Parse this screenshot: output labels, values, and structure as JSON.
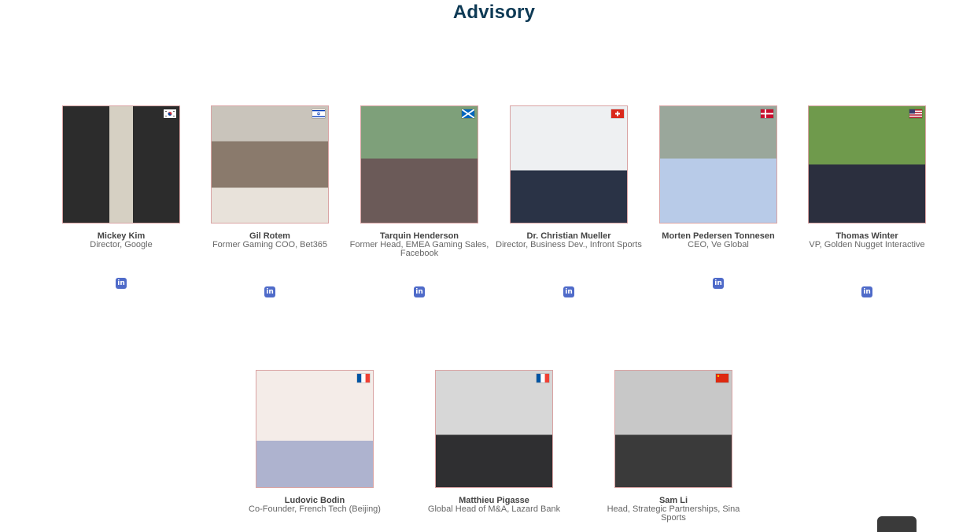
{
  "page": {
    "title": "Advisory"
  },
  "advisors_row1": [
    {
      "name": "Mickey Kim",
      "role": "Director, Google",
      "flag": "korea",
      "social_icon": "linkedin-icon"
    },
    {
      "name": "Gil Rotem",
      "role": "Former Gaming COO, Bet365",
      "flag": "israel",
      "social_icon": "linkedin-icon"
    },
    {
      "name": "Tarquin Henderson",
      "role": "Former Head, EMEA Gaming Sales, Facebook",
      "flag": "scotland",
      "social_icon": "linkedin-icon"
    },
    {
      "name": "Dr. Christian Mueller",
      "role": "Director, Business Dev., Infront Sports",
      "flag": "switzerland",
      "social_icon": "linkedin-icon"
    },
    {
      "name": "Morten Pedersen Tonnesen",
      "role": "CEO, Ve Global",
      "flag": "denmark",
      "social_icon": "linkedin-icon"
    },
    {
      "name": "Thomas Winter",
      "role": "VP, Golden Nugget Interactive",
      "flag": "usa",
      "social_icon": "linkedin-icon"
    }
  ],
  "advisors_row2": [
    {
      "name": "Ludovic Bodin",
      "role": "Co-Founder, French Tech (Beijing)",
      "flag": "france"
    },
    {
      "name": "Matthieu Pigasse",
      "role": "Global Head of M&A, Lazard Bank",
      "flag": "france"
    },
    {
      "name": "Sam Li",
      "role": "Head, Strategic Partnerships, Sina Sports",
      "flag": "china"
    }
  ],
  "colors": {
    "title": "#0e3a55",
    "linkedin": "#4f6bc9",
    "photo_border": "#d9a3a3"
  }
}
